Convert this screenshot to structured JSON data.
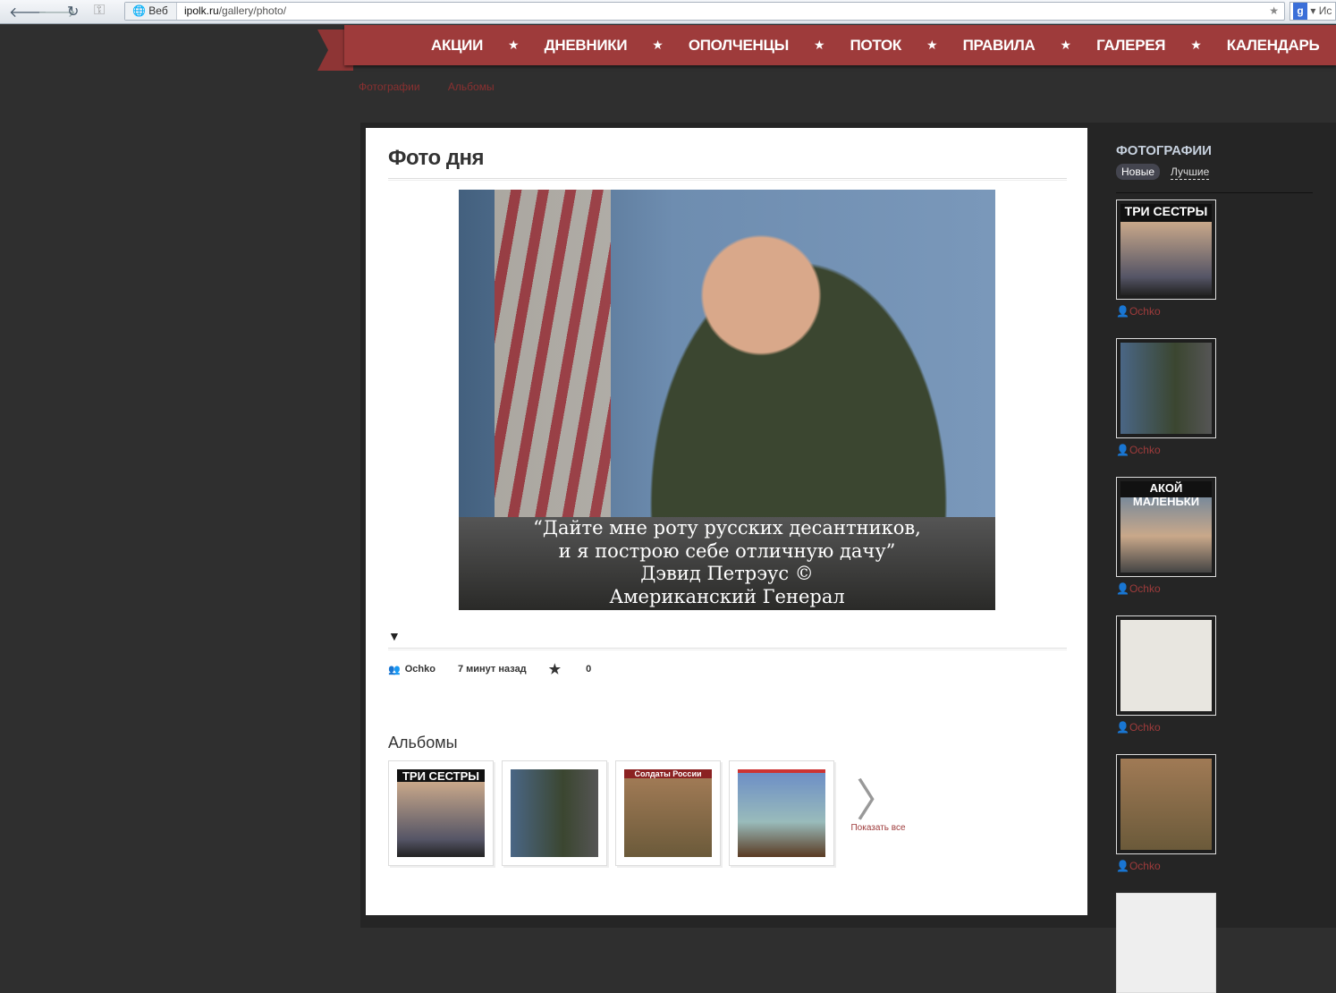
{
  "browser": {
    "omnibox_chip": "Веб",
    "url_host": "ipolk.ru",
    "url_path": "/gallery/photo/",
    "search_label": "Ис"
  },
  "nav": {
    "items": [
      "АКЦИИ",
      "ДНЕВНИКИ",
      "ОПОЛЧЕНЦЫ",
      "ПОТОК",
      "ПРАВИЛА",
      "ГАЛЕРЕЯ",
      "КАЛЕНДАРЬ"
    ]
  },
  "subnav": [
    "Фотографии",
    "Альбомы"
  ],
  "main": {
    "title": "Фото дня",
    "photo_caption": [
      "“Дайте мне роту русских десантников,",
      "и я построю себе отличную дачу”",
      "Дэвид Петрэус ©",
      "Американский Генерал"
    ],
    "author": "Ochko",
    "time": "7 минут назад",
    "rating": "0",
    "albums_title": "Альбомы",
    "albums": [
      {
        "caption": "ТРИ СЕСТРЫ"
      },
      {
        "caption": ""
      },
      {
        "caption": "Солдаты России"
      },
      {
        "caption": ""
      }
    ],
    "show_all": "Показать все"
  },
  "sidebar": {
    "title": "ФОТОГРАФИИ",
    "tabs": [
      "Новые",
      "Лучшие"
    ],
    "items": [
      {
        "caption": "ТРИ СЕСТРЫ",
        "author": "Ochko"
      },
      {
        "caption": "",
        "author": "Ochko"
      },
      {
        "caption": "АКОЙ МАЛЕНЬКИ",
        "author": "Ochko"
      },
      {
        "caption": "",
        "author": "Ochko"
      },
      {
        "caption": "",
        "author": "Ochko"
      }
    ]
  }
}
